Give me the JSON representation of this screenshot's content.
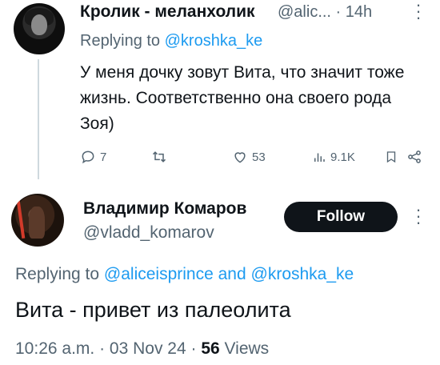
{
  "tweet1": {
    "author_name": "Кролик - меланхолик",
    "author_handle": "@alic...",
    "separator": "·",
    "time": "14h",
    "replying_prefix": "Replying to",
    "replying_to": "@kroshka_ke",
    "text": "У меня дочку зовут Вита, что значит тоже жизнь. Соответственно она своего рода Зоя)",
    "stats": {
      "replies": "7",
      "retweets": "",
      "likes": "53",
      "views": "9.1K"
    }
  },
  "tweet2": {
    "author_name": "Владимир Комаров",
    "author_handle": "@vladd_komarov",
    "follow_label": "Follow",
    "replying_prefix": "Replying to",
    "replying_to_1": "@aliceisprince",
    "replying_and": "and",
    "replying_to_2": "@kroshka_ke",
    "text": "Вита - привет из палеолита",
    "time": "10:26 a.m.",
    "separator": "·",
    "date": "03 Nov 24",
    "views_count": "56",
    "views_label": "Views"
  },
  "icons": [
    "reply-icon",
    "retweet-icon",
    "like-icon",
    "views-icon",
    "bookmark-icon",
    "share-icon",
    "more-icon"
  ],
  "colors": {
    "accent": "#1d9bf0",
    "muted": "#536471",
    "text": "#0f1419",
    "thread_line": "#cfd9de"
  }
}
